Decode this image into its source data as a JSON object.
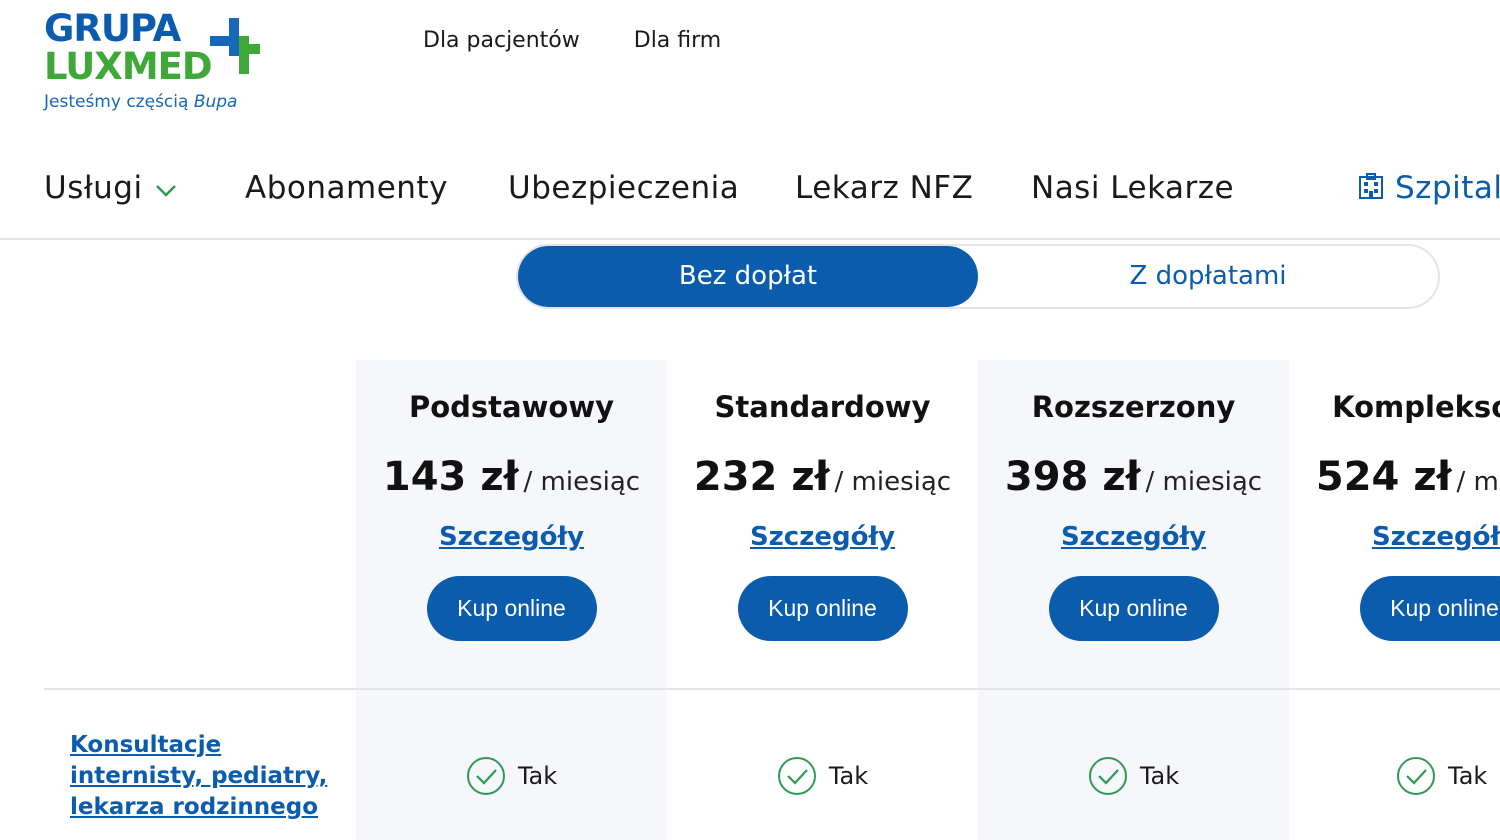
{
  "logo": {
    "line1": "GRUPA",
    "line2": "LUXMED",
    "tagline": "Jesteśmy częścią",
    "tagline_brand": "Bupa"
  },
  "top_links": [
    "Dla pacjentów",
    "Dla firm"
  ],
  "nav": {
    "uslugi": "Usługi",
    "abonamenty": "Abonamenty",
    "ubezpieczenia": "Ubezpieczenia",
    "lekarz_nfz": "Lekarz NFZ",
    "nasi_lekarze": "Nasi Lekarze",
    "szpital": "Szpital"
  },
  "toggle": {
    "active": "Bez dopłat",
    "inactive": "Z dopłatami"
  },
  "plans": [
    {
      "name": "Podstawowy",
      "price": "143 zł",
      "period": "/ miesiąc",
      "details": "Szczegóły",
      "buy": "Kup online"
    },
    {
      "name": "Standardowy",
      "price": "232 zł",
      "period": "/ miesiąc",
      "details": "Szczegóły",
      "buy": "Kup online"
    },
    {
      "name": "Rozszerzony",
      "price": "398 zł",
      "period": "/ miesiąc",
      "details": "Szczegóły",
      "buy": "Kup online"
    },
    {
      "name": "Kompleksowy",
      "price": "524 zł",
      "period": "/ miesiąc",
      "details": "Szczegóły",
      "buy": "Kup online"
    }
  ],
  "feature_row": {
    "label": "Konsultacje internisty, pediatry, lekarza rodzinnego",
    "values": [
      "Tak",
      "Tak",
      "Tak",
      "Tak"
    ]
  },
  "colors": {
    "brand_blue": "#0b5cad",
    "brand_green": "#3ea838",
    "column_bg": "#f5f7fb",
    "check_green": "#2e9a54"
  },
  "icons": {
    "logo_mark": "plus-cross-icon",
    "nav_chevron": "chevron-down-icon",
    "hospital": "hospital-icon",
    "feature_check": "check-circle-icon"
  }
}
